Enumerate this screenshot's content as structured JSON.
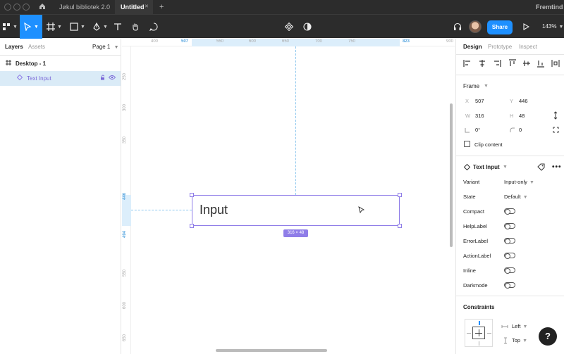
{
  "titlebar": {
    "tabs": [
      {
        "label": "Jøkul bibliotek 2.0"
      },
      {
        "label": "Untitled",
        "close": "✕"
      }
    ],
    "add_tab": "+",
    "workspace": "Fremtind"
  },
  "toolbar": {
    "share_label": "Share",
    "zoom_label": "143%"
  },
  "left_panel": {
    "tabs": [
      "Layers",
      "Assets"
    ],
    "page_label": "Page 1",
    "layers": [
      {
        "label": "Desktop - 1"
      },
      {
        "label": "Text Input"
      }
    ]
  },
  "canvas": {
    "ruler_top": [
      "400",
      "507",
      "550",
      "600",
      "650",
      "700",
      "750",
      "823",
      "900"
    ],
    "ruler_left": [
      "250",
      "300",
      "350",
      "446",
      "494",
      "550",
      "600",
      "650"
    ],
    "input_text": "Input",
    "size_badge": "316 × 48"
  },
  "right_panel": {
    "tabs": [
      "Design",
      "Prototype",
      "Inspect"
    ],
    "frame_title": "Frame",
    "x_label": "X",
    "x_value": "507",
    "y_label": "Y",
    "y_value": "446",
    "w_label": "W",
    "w_value": "316",
    "h_label": "H",
    "h_value": "48",
    "rotation_value": "0°",
    "radius_value": "0",
    "clip_content_label": "Clip content",
    "component_title": "Text Input",
    "properties": [
      {
        "label": "Variant",
        "value": "Input-only"
      },
      {
        "label": "State",
        "value": "Default"
      }
    ],
    "toggles": [
      {
        "label": "Compact"
      },
      {
        "label": "HelpLabel"
      },
      {
        "label": "ErrorLabel"
      },
      {
        "label": "ActionLabel"
      },
      {
        "label": "Inline"
      },
      {
        "label": "Darkmode"
      }
    ],
    "constraints_title": "Constraints",
    "constraint_h": "Left",
    "constraint_v": "Top"
  },
  "help_label": "?",
  "colors": {
    "accent": "#1e90ff",
    "selection": "#8f7de8",
    "chrome": "#2c2c2c"
  }
}
